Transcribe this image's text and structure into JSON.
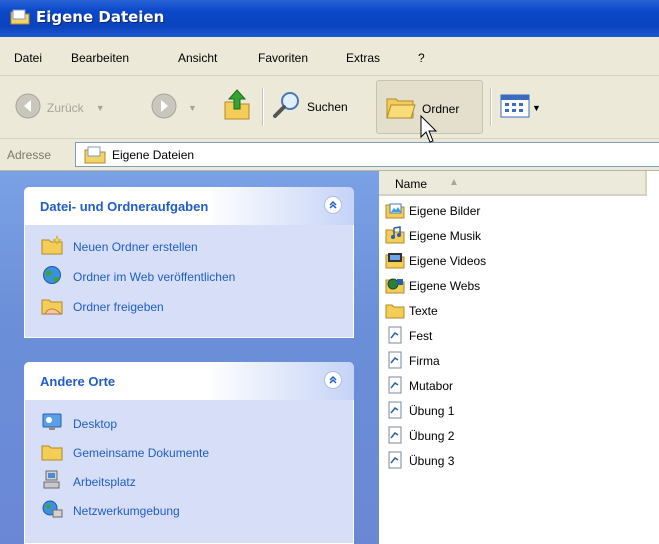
{
  "window": {
    "title": "Eigene Dateien"
  },
  "menu": [
    "Datei",
    "Bearbeiten",
    "Ansicht",
    "Favoriten",
    "Extras",
    "?"
  ],
  "toolbar": {
    "back_label": "Zurück",
    "search_label": "Suchen",
    "folders_label": "Ordner"
  },
  "address": {
    "label": "Adresse",
    "value": "Eigene Dateien"
  },
  "task_panels": [
    {
      "title": "Datei- und Ordneraufgaben",
      "items": [
        {
          "label": "Neuen Ordner erstellen",
          "icon": "new-folder-icon"
        },
        {
          "label": "Ordner im Web veröffentlichen",
          "icon": "globe-icon"
        },
        {
          "label": "Ordner freigeben",
          "icon": "share-folder-icon"
        }
      ]
    },
    {
      "title": "Andere Orte",
      "items": [
        {
          "label": "Desktop",
          "icon": "desktop-icon"
        },
        {
          "label": "Gemeinsame Dokumente",
          "icon": "folder-icon"
        },
        {
          "label": "Arbeitsplatz",
          "icon": "computer-icon"
        },
        {
          "label": "Netzwerkumgebung",
          "icon": "network-icon"
        }
      ]
    }
  ],
  "file_list": {
    "column_name": "Name",
    "items": [
      {
        "label": "Eigene Bilder",
        "icon": "pictures-folder-icon"
      },
      {
        "label": "Eigene Musik",
        "icon": "music-folder-icon"
      },
      {
        "label": "Eigene Videos",
        "icon": "videos-folder-icon"
      },
      {
        "label": "Eigene Webs",
        "icon": "webs-folder-icon"
      },
      {
        "label": "Texte",
        "icon": "folder-icon"
      },
      {
        "label": "Fest",
        "icon": "document-icon"
      },
      {
        "label": "Firma",
        "icon": "document-icon"
      },
      {
        "label": "Mutabor",
        "icon": "document-icon"
      },
      {
        "label": "Übung 1",
        "icon": "document-icon"
      },
      {
        "label": "Übung 2",
        "icon": "document-icon"
      },
      {
        "label": "Übung 3",
        "icon": "document-icon"
      }
    ]
  },
  "colors": {
    "title_bar": "#0b43be",
    "chrome": "#ece9d8",
    "task_pane": "#6b8fd8",
    "task_link": "#215dc6"
  }
}
